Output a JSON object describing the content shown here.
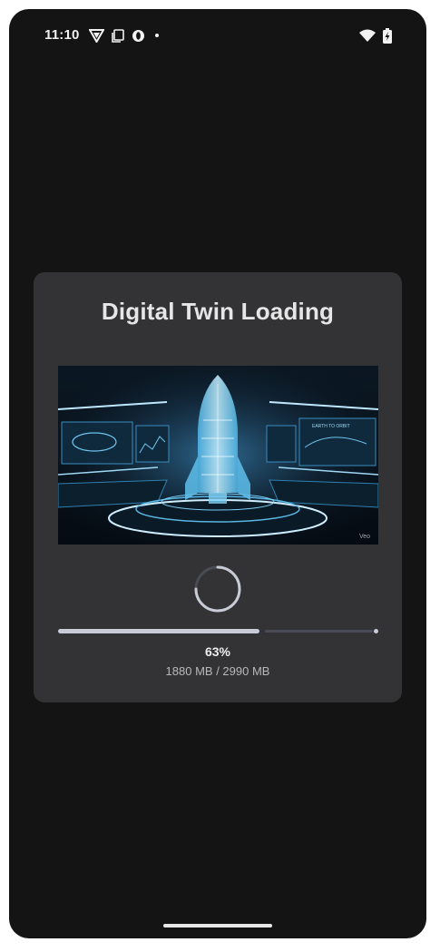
{
  "status_bar": {
    "time": "11:10",
    "left_icons": [
      "vpn-shield-icon",
      "screenshot-icon",
      "circle-app-icon",
      "dot-icon"
    ],
    "right_icons": [
      "wifi-icon",
      "battery-charging-icon"
    ]
  },
  "dialog": {
    "title": "Digital Twin Loading",
    "image": {
      "subject": "holographic-rocket-control-room",
      "watermark": "Veo",
      "panel_label": "EARTH TO ORBIT"
    },
    "progress": {
      "percent_label": "63%",
      "fraction": 0.63,
      "size_label": "1880 MB / 2990 MB"
    }
  },
  "colors": {
    "background": "#141415",
    "card": "#333335",
    "progress_fill": "#c9cbd6",
    "progress_track": "#4a4c55"
  }
}
